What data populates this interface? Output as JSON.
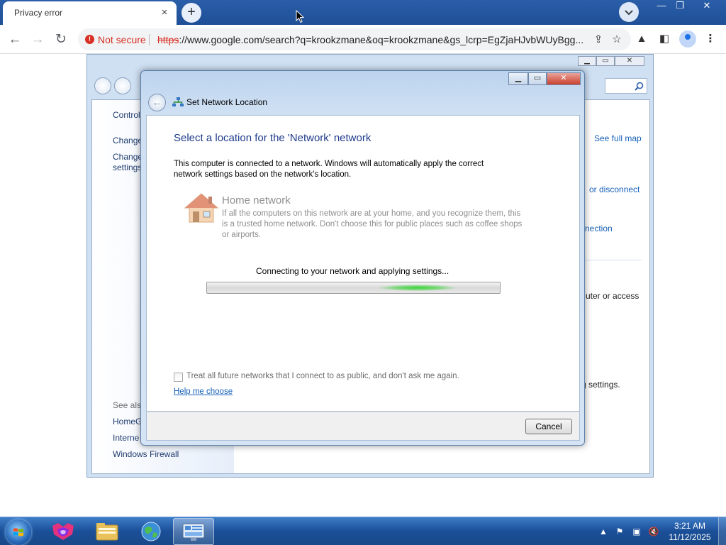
{
  "browser": {
    "tab_title": "Privacy error",
    "tab_close": "×",
    "new_tab": "+",
    "security_label": "Not secure",
    "url_scheme": "https",
    "url_rest": "://www.google.com/search?q=krookzmane&oq=krookzmane&gs_lcrp=EgZjaHJvbWUyBgg...",
    "window_controls": {
      "minimize": "—",
      "restore": "❐",
      "close": "✕"
    }
  },
  "control_panel": {
    "left_nav": {
      "control_home": "Control",
      "change_adapter": "Change",
      "change_advanced_1": "Change",
      "change_advanced_2": "settings",
      "see_also": "See also",
      "homegroup": "HomeG",
      "internet_options": "Interne",
      "windows_firewall": "Windows Firewall"
    },
    "right_links": {
      "see_full_map": "See full map",
      "connect_disconnect": "or disconnect",
      "connection": "nection",
      "computer_access": "uter or access",
      "settings": "g settings."
    }
  },
  "dialog": {
    "title": "Set Network Location",
    "heading": "Select a location for the 'Network' network",
    "description": "This computer is connected to a network. Windows will automatically apply the correct network settings based on the network's location.",
    "option_title": "Home network",
    "option_description": "If all the computers on this network are at your home, and you recognize them, this is a trusted home network.  Don't choose this for public places such as coffee shops or airports.",
    "status": "Connecting to your network and applying settings...",
    "progress_marquee_position": 0.72,
    "checkbox_label": "Treat all future networks that I connect to as public, and don't ask me again.",
    "checkbox_checked": false,
    "help_link": "Help me choose",
    "cancel_label": "Cancel"
  },
  "taskbar": {
    "time": "3:21 AM",
    "date": "11/12/2025",
    "pinned": [
      "firefox-icon",
      "explorer-folder-icon",
      "network-globe-icon",
      "control-panel-icon"
    ]
  },
  "colors": {
    "accent_blue": "#1e3a8a",
    "link_blue": "#1660b8",
    "warning_red": "#d93025",
    "progress_green": "#3ed43b"
  }
}
